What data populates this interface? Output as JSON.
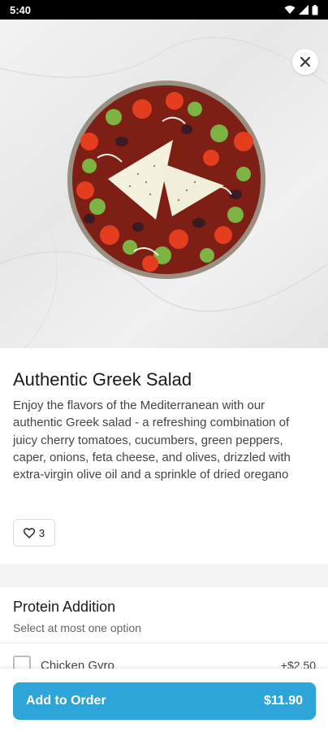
{
  "status_bar": {
    "time": "5:40"
  },
  "product": {
    "title": "Authentic Greek Salad",
    "description": "Enjoy the flavors of the Mediterranean with our authentic Greek salad - a refreshing combination of juicy cherry tomatoes, cucumbers, green peppers, caper, onions, feta cheese, and olives, drizzled with extra-virgin olive oil and a sprinkle of dried oregano",
    "likes": "3"
  },
  "options_section": {
    "title": "Protein Addition",
    "subtitle": "Select at most one option",
    "options": [
      {
        "name": "Chicken Gyro",
        "price": "+$2.50",
        "checked": false
      }
    ]
  },
  "footer": {
    "button_label": "Add to Order",
    "price": "$11.90"
  },
  "colors": {
    "accent": "#2ea5d9"
  },
  "icons": [
    "wifi-icon",
    "signal-icon",
    "battery-icon",
    "close-icon",
    "heart-icon",
    "checkbox-icon"
  ]
}
